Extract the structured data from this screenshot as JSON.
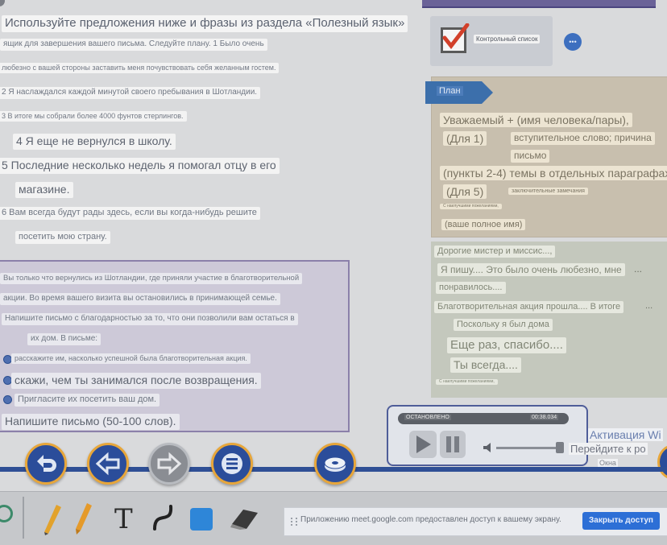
{
  "instruction": {
    "heading": "Используйте предложения ниже и фразы из раздела «Полезный язык»",
    "line1": "ящик для завершения вашего письма. Следуйте плану. 1 Было очень",
    "line2": "любезно с вашей стороны заставить меня почувствовать себя желанным гостем.",
    "line3": "2 Я наслаждался каждой минутой своего пребывания в Шотландии.",
    "line4": "3 В итоге мы собрали более 4000 фунтов стерлингов.",
    "line5": "4 Я еще не вернулся в школу.",
    "line6a": "5 Последние несколько недель я помогал отцу в его",
    "line6b": "магазине.",
    "line7a": "6 Вам всегда будут рады здесь, если вы когда-нибудь решите",
    "line7b": "посетить мою страну."
  },
  "task": {
    "line1": "Вы только что вернулись из Шотландии, где приняли участие в благотворительной",
    "line2": "акции. Во время вашего визита вы остановились в принимающей семье.",
    "line3": "Напишите письмо с благодарностью за то, что они позволили вам остаться в",
    "line4": "их дом. В письме:",
    "bullet1": "расскажите им, насколько успешной была благотворительная акция.",
    "bullet2": "скажи, чем ты занимался после возвращения.",
    "bullet3": "Пригласите их посетить ваш дом.",
    "final": "Напишите письмо (50-100 слов)."
  },
  "checklist": {
    "label": "Контрольный список",
    "more": "•••"
  },
  "plan": {
    "tag": "План",
    "row1": "Уважаемый + (имя человека/пары),",
    "row2_num": "(Для 1)",
    "row2_text_a": "вступительное слово; причина",
    "row2_text_b": "письмо",
    "row3": "(пункты 2-4) темы в отдельных параграфах",
    "row4_num": "(Для 5)",
    "row4_text": "заключительные замечания",
    "row5": "С наилучшими пожеланиями,",
    "row6": "(ваше полное имя)"
  },
  "letter": {
    "l1": "Дорогие мистер и миссис...,",
    "l2": "Я пишу.... Это было очень любезно, мне",
    "l3": "понравилось....",
    "l4": "Благотворительная акция прошла.... В итоге",
    "l5": "Поскольку я был дома",
    "l6": "Еще раз, спасибо....",
    "l7": "Ты всегда....",
    "l8": "С наилучшими пожеланиями,",
    "dots": "...",
    "dots2": "..."
  },
  "player": {
    "status": "ОСТАНОВЛЕНО",
    "time": "00:38.034"
  },
  "activation": {
    "title": "Активация Wi",
    "line2": "Перейдите к ро",
    "line3": "Окна"
  },
  "toolbar": {
    "text_tool": "T"
  },
  "share": {
    "message": "Приложению meet.google.com предоставлен доступ к вашему экрану.",
    "button": "Закрыть доступ"
  }
}
